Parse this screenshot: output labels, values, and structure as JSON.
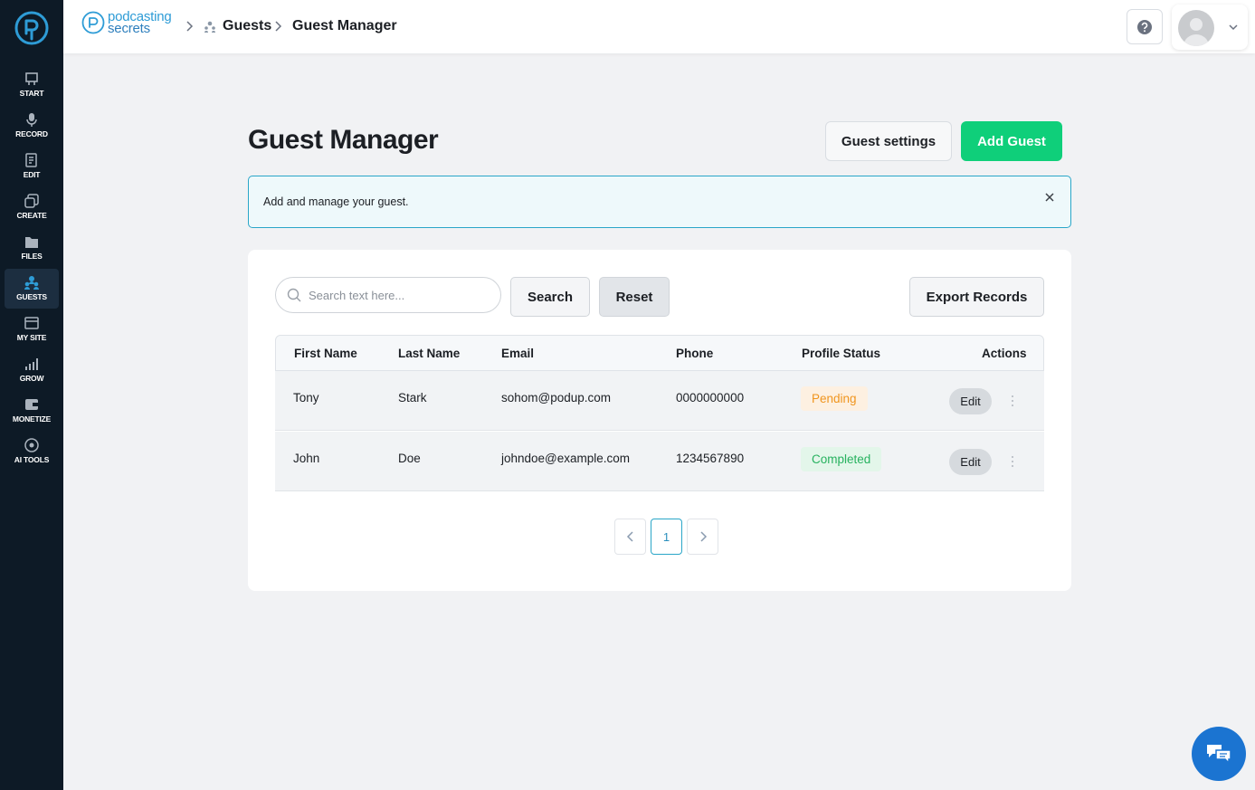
{
  "sidebar": {
    "logo": "podcasting-secrets-mark",
    "items": [
      {
        "label": "START",
        "icon": "start-icon"
      },
      {
        "label": "RECORD",
        "icon": "microphone-icon"
      },
      {
        "label": "EDIT",
        "icon": "edit-icon"
      },
      {
        "label": "CREATE",
        "icon": "create-icon"
      },
      {
        "label": "FILES",
        "icon": "files-icon"
      },
      {
        "label": "GUESTS",
        "icon": "guests-icon",
        "active": true
      },
      {
        "label": "MY SITE",
        "icon": "site-icon"
      },
      {
        "label": "GROW",
        "icon": "grow-icon"
      },
      {
        "label": "MONETIZE",
        "icon": "monetize-icon"
      },
      {
        "label": "AI TOOLS",
        "icon": "ai-tools-icon"
      }
    ]
  },
  "header": {
    "brand_line1": "podcasting",
    "brand_line2": "secrets",
    "breadcrumb": [
      "Guests",
      "Guest Manager"
    ]
  },
  "page": {
    "title": "Guest Manager",
    "settings_label": "Guest settings",
    "add_label": "Add Guest",
    "notice": "Add and manage your guest."
  },
  "toolbar": {
    "search_placeholder": "Search text here...",
    "search_label": "Search",
    "reset_label": "Reset",
    "export_label": "Export Records"
  },
  "table": {
    "columns": [
      "First Name",
      "Last Name",
      "Email",
      "Phone",
      "Profile Status",
      "Actions"
    ],
    "rows": [
      {
        "first": "Tony",
        "last": "Stark",
        "email": "sohom@podup.com",
        "phone": "0000000000",
        "status": "Pending",
        "action": "Edit"
      },
      {
        "first": "John",
        "last": "Doe",
        "email": "johndoe@example.com",
        "phone": "1234567890",
        "status": "Completed",
        "action": "Edit"
      }
    ]
  },
  "pagination": {
    "current": "1"
  },
  "colors": {
    "sidebar": "#0d1a26",
    "accent": "#0fcf7a",
    "notice_border": "#2aa6c8",
    "pending": "#f0951e",
    "completed": "#27b25f",
    "chat": "#1b74d1"
  }
}
